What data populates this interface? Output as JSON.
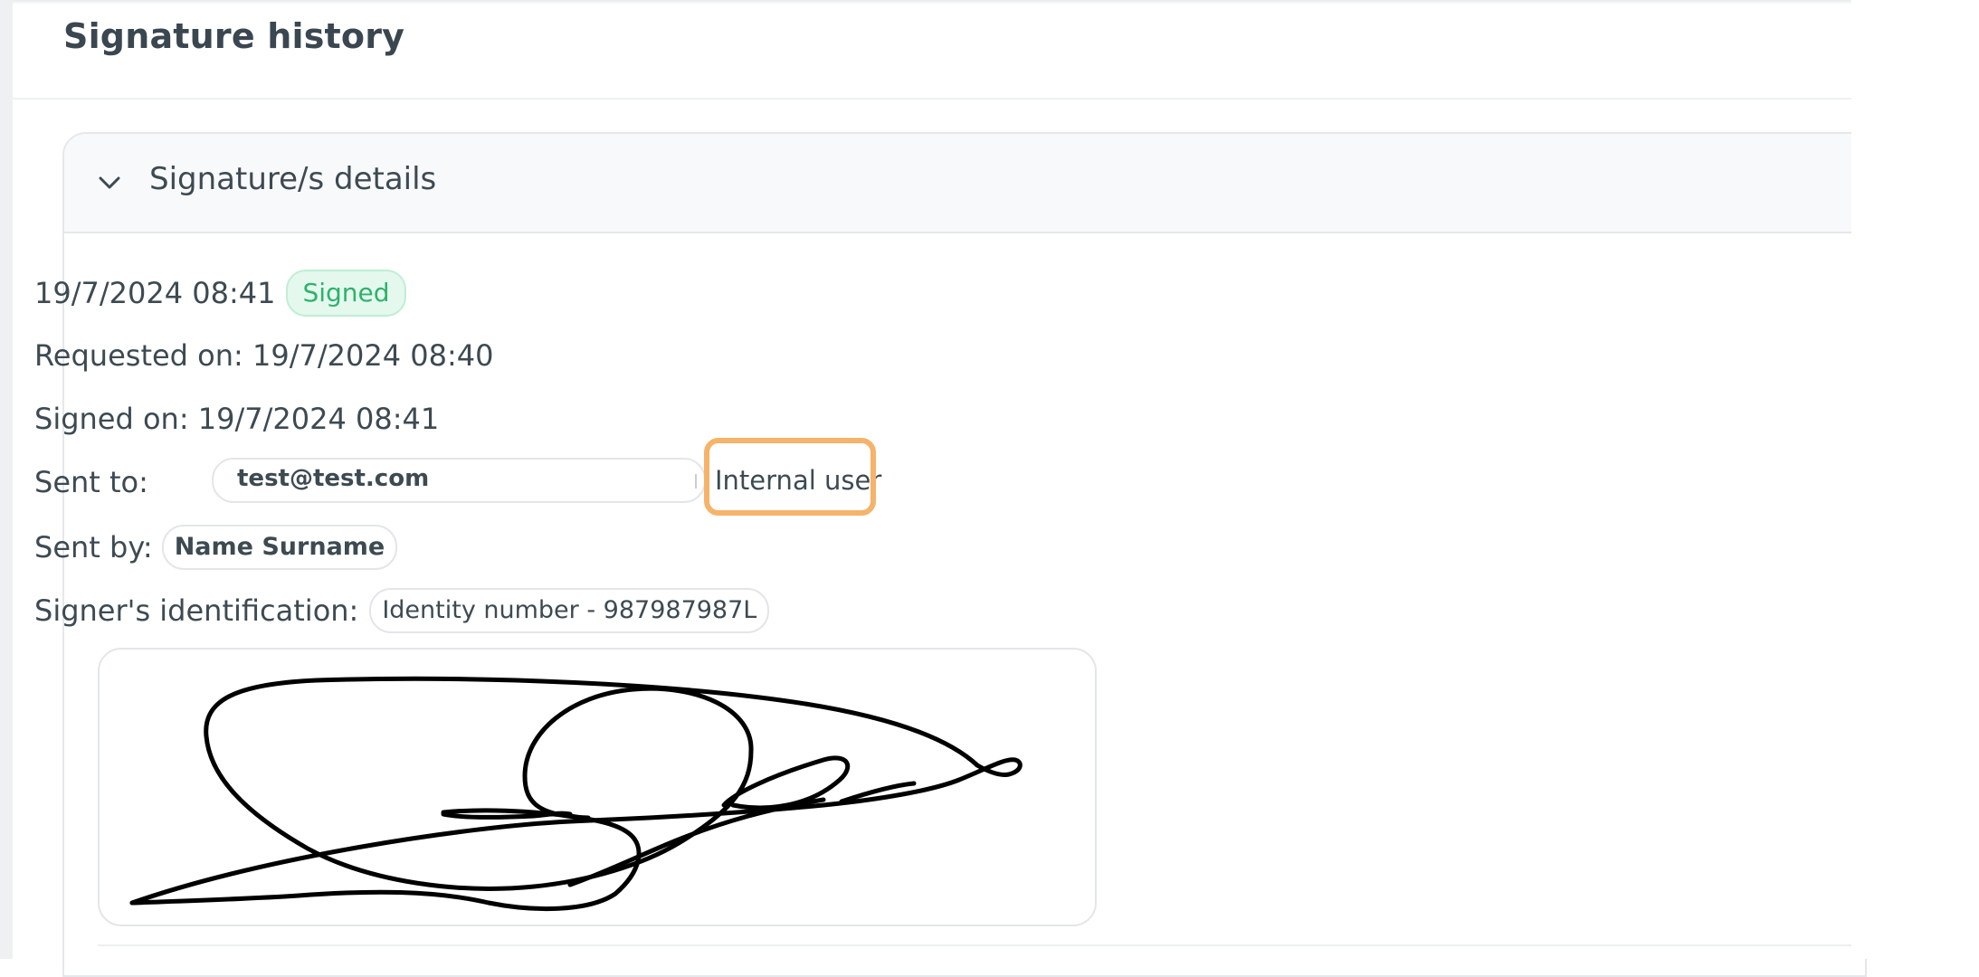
{
  "page": {
    "title": "Signature history"
  },
  "panel": {
    "title": "Signature/s details",
    "expanded": true
  },
  "entry": {
    "datetime": "19/7/2024 08:41",
    "status": "Signed",
    "requested_on": "Requested on: 19/7/2024 08:40",
    "signed_on": "Signed on: 19/7/2024 08:41",
    "sent_to_label": "Sent to:",
    "sent_to_email": "test@test.com",
    "sent_to_type": "Internal user",
    "sent_by_label": "Sent by:",
    "sent_by_name": "Name Surname",
    "signer_id_label": "Signer's identification:",
    "signer_id_value": "Identity number - 987987987L"
  },
  "colors": {
    "signed_badge": "#2fb26b",
    "highlight": "#f6b36a"
  },
  "icons": {
    "panel_toggle": "chevron-down-icon"
  }
}
